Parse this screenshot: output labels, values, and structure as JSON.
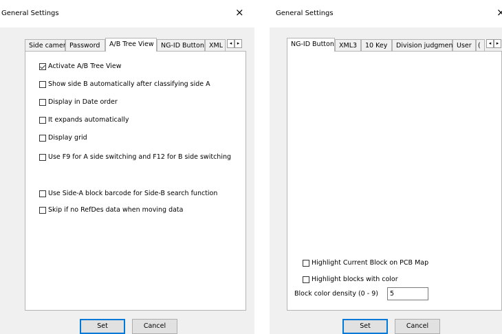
{
  "left_dialog": {
    "title": "General Settings",
    "close_glyph": "×",
    "tabs": [
      "Side camera",
      "Password",
      "A/B Tree View",
      "NG-ID Button",
      "XML"
    ],
    "active_tab": "A/B Tree View",
    "scroll_left": "◂",
    "scroll_right": "▸",
    "options": [
      {
        "label": "Activate A/B Tree View",
        "checked": true
      },
      {
        "label": "Show side B automatically after classifying side A",
        "checked": false
      },
      {
        "label": "Display in Date order",
        "checked": false
      },
      {
        "label": "It expands automatically",
        "checked": false
      },
      {
        "label": "Display grid",
        "checked": false
      },
      {
        "label": "Use F9 for A side switching and F12 for B side switching",
        "checked": false
      },
      {
        "label": "Use Side-A block barcode for Side-B search function",
        "checked": false
      },
      {
        "label": "Skip if no RefDes data when moving data",
        "checked": false
      }
    ],
    "set_label": "Set",
    "cancel_label": "Cancel"
  },
  "right_dialog": {
    "title": "General Settings",
    "close_glyph": "×",
    "tabs": [
      "NG-ID Button",
      "XML3",
      "10 Key",
      "Division judgment",
      "User",
      "("
    ],
    "active_tab": "NG-ID Button",
    "scroll_left": "◂",
    "scroll_right": "▸",
    "options": [
      {
        "label": "Highlight Current Block on PCB Map",
        "checked": false
      },
      {
        "label": "Highlight blocks with color",
        "checked": false
      }
    ],
    "density_label": "Block color density (0 - 9)",
    "density_value": "5",
    "set_label": "Set",
    "cancel_label": "Cancel"
  },
  "icons": {
    "close": "close-icon",
    "checkbox": "checkbox-icon",
    "scroll_left": "arrow-left-icon",
    "scroll_right": "arrow-right-icon"
  }
}
